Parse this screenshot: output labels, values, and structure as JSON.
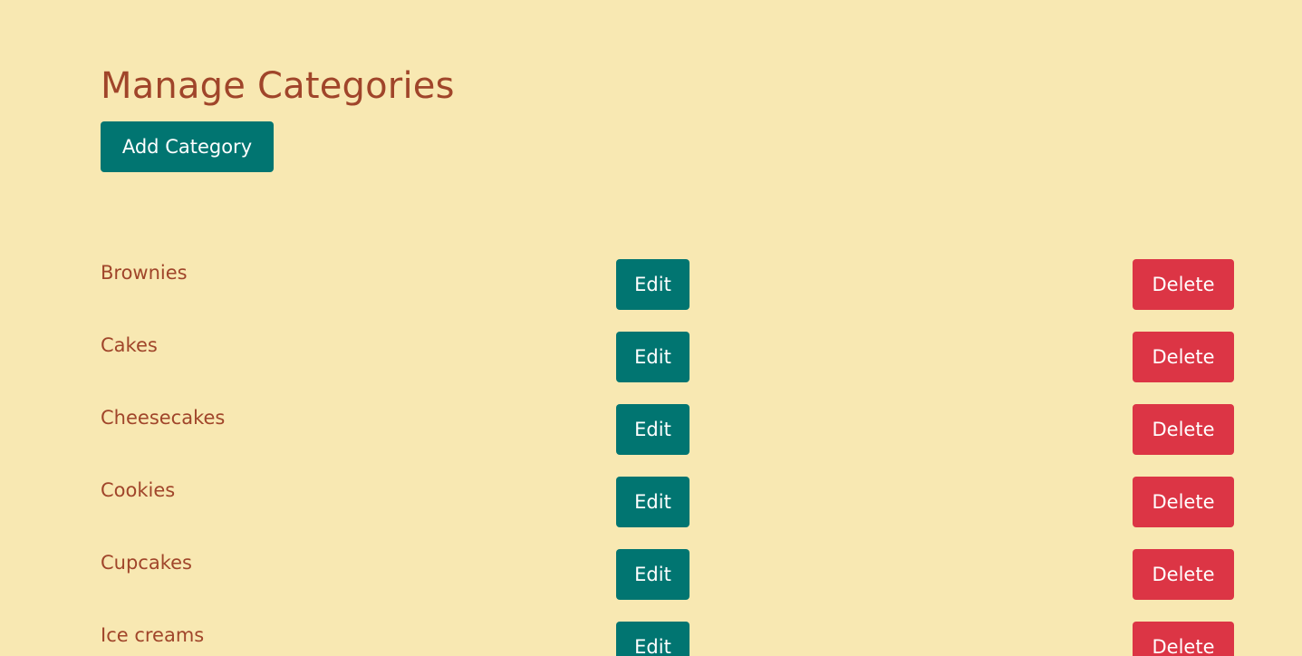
{
  "page": {
    "title": "Manage Categories",
    "add_button_label": "Add Category"
  },
  "categories": [
    {
      "name": "Brownies",
      "edit_label": "Edit",
      "delete_label": "Delete"
    },
    {
      "name": "Cakes",
      "edit_label": "Edit",
      "delete_label": "Delete"
    },
    {
      "name": "Cheesecakes",
      "edit_label": "Edit",
      "delete_label": "Delete"
    },
    {
      "name": "Cookies",
      "edit_label": "Edit",
      "delete_label": "Delete"
    },
    {
      "name": "Cupcakes",
      "edit_label": "Edit",
      "delete_label": "Delete"
    },
    {
      "name": "Ice creams",
      "edit_label": "Edit",
      "delete_label": "Delete"
    }
  ],
  "colors": {
    "background": "#f8e8b2",
    "text_brand": "#a0452a",
    "primary_button": "#017571",
    "danger_button": "#dc3545"
  }
}
